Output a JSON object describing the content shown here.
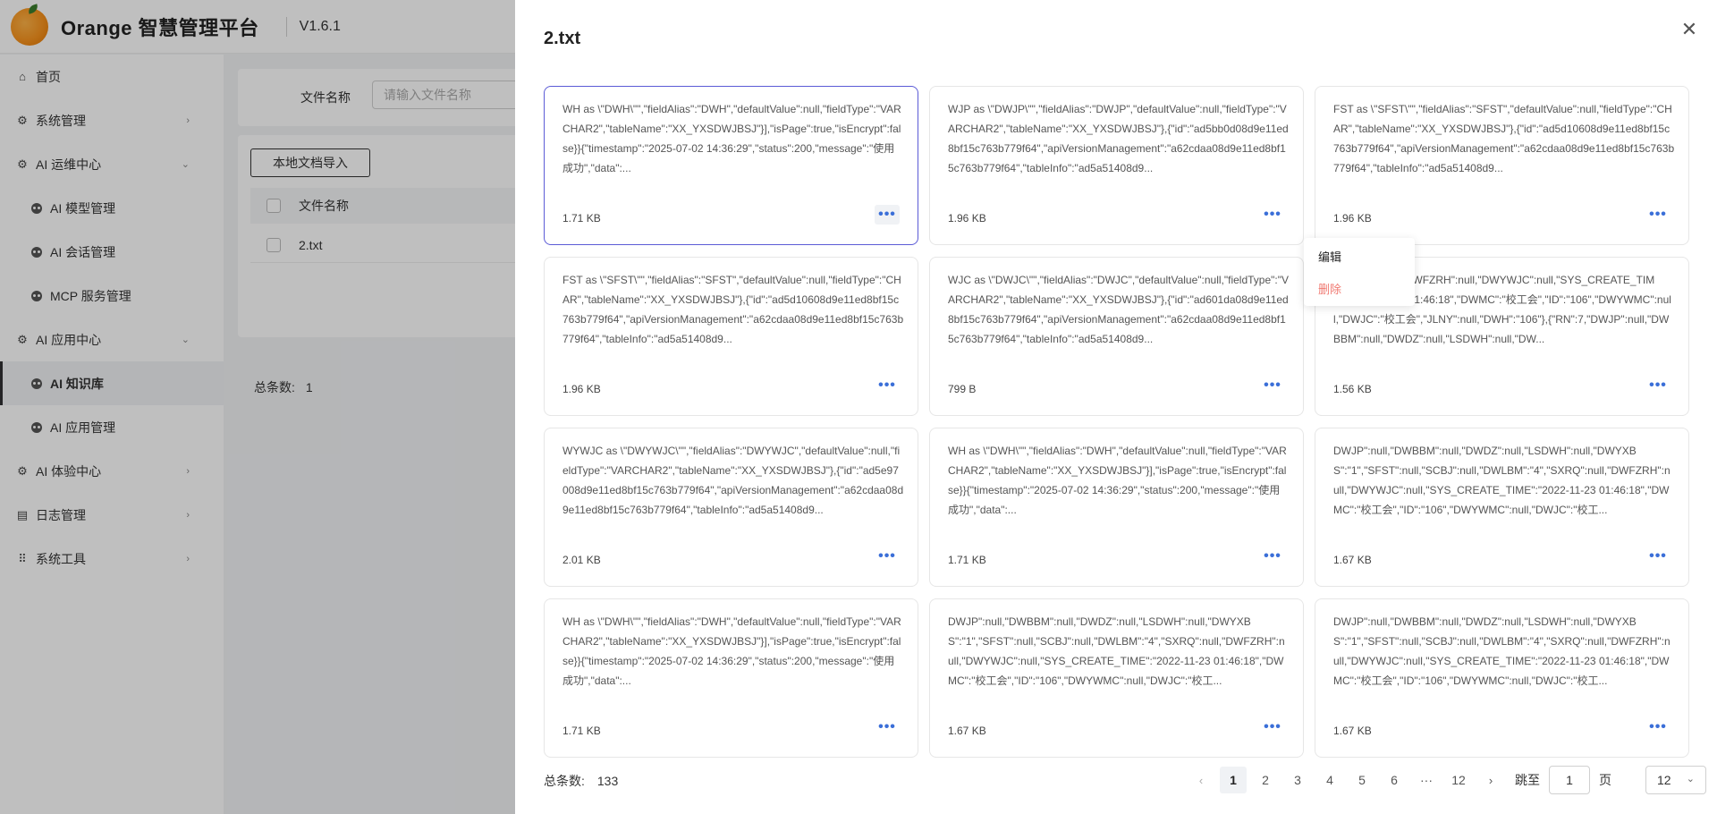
{
  "header": {
    "title": "Orange 智慧管理平台",
    "version": "V1.6.1"
  },
  "sidebar": {
    "items": [
      {
        "label": "首页",
        "icon": "home-icon"
      },
      {
        "label": "系统管理",
        "icon": "gear-icon"
      },
      {
        "label": "AI 运维中心",
        "icon": "gear-icon"
      },
      {
        "label": "AI 模型管理",
        "icon": "ai-icon"
      },
      {
        "label": "AI 会话管理",
        "icon": "ai-icon"
      },
      {
        "label": "MCP 服务管理",
        "icon": "ai-icon"
      },
      {
        "label": "AI 应用中心",
        "icon": "gear-icon"
      },
      {
        "label": "AI 知识库",
        "icon": "ai-icon"
      },
      {
        "label": "AI 应用管理",
        "icon": "ai-icon"
      },
      {
        "label": "AI 体验中心",
        "icon": "gear-icon"
      },
      {
        "label": "日志管理",
        "icon": "log-icon"
      },
      {
        "label": "系统工具",
        "icon": "grid-icon"
      }
    ]
  },
  "main": {
    "search_label": "文件名称",
    "search_placeholder": "请输入文件名称",
    "import_button": "本地文档导入",
    "column_name": "文件名称",
    "rows": [
      "2.txt"
    ],
    "total_label": "总条数:",
    "total_value": "1"
  },
  "drawer": {
    "title": "2.txt",
    "cards": [
      {
        "text": "WH as \\\"DWH\\\"\",\"fieldAlias\":\"DWH\",\"defaultValue\":null,\"fieldType\":\"VARCHAR2\",\"tableName\":\"XX_YXSDWJBSJ\"}],\"isPage\":true,\"isEncrypt\":false}}{\"timestamp\":\"2025-07-02 14:36:29\",\"status\":200,\"message\":\"使用成功\",\"data\":...",
        "size": "1.71 KB"
      },
      {
        "text": "WJP as \\\"DWJP\\\"\",\"fieldAlias\":\"DWJP\",\"defaultValue\":null,\"fieldType\":\"VARCHAR2\",\"tableName\":\"XX_YXSDWJBSJ\"},{\"id\":\"ad5bb0d08d9e11ed8bf15c763b779f64\",\"apiVersionManagement\":\"a62cdaa08d9e11ed8bf15c763b779f64\",\"tableInfo\":\"ad5a51408d9...",
        "size": "1.96 KB"
      },
      {
        "text": "FST as \\\"SFST\\\"\",\"fieldAlias\":\"SFST\",\"defaultValue\":null,\"fieldType\":\"CHAR\",\"tableName\":\"XX_YXSDWJBSJ\"},{\"id\":\"ad5d10608d9e11ed8bf15c763b779f64\",\"apiVersionManagement\":\"a62cdaa08d9e11ed8bf15c763b779f64\",\"tableInfo\":\"ad5a51408d9...",
        "size": "1.96 KB"
      },
      {
        "text": "FST as \\\"SFST\\\"\",\"fieldAlias\":\"SFST\",\"defaultValue\":null,\"fieldType\":\"CHAR\",\"tableName\":\"XX_YXSDWJBSJ\"},{\"id\":\"ad5d10608d9e11ed8bf15c763b779f64\",\"apiVersionManagement\":\"a62cdaa08d9e11ed8bf15c763b779f64\",\"tableInfo\":\"ad5a51408d9...",
        "size": "1.96 KB"
      },
      {
        "text": "WJC as \\\"DWJC\\\"\",\"fieldAlias\":\"DWJC\",\"defaultValue\":null,\"fieldType\":\"VARCHAR2\",\"tableName\":\"XX_YXSDWJBSJ\"},{\"id\":\"ad601da08d9e11ed8bf15c763b779f64\",\"apiVersionManagement\":\"a62cdaa08d9e11ed8bf15c763b779f64\",\"tableInfo\":\"ad5a51408d9...",
        "size": "799 B"
      },
      {
        "text": "\",\"SXRQ\":null,\"DWFZRH\":null,\"DWYWJC\":null,\"SYS_CREATE_TIME\":\"2022-11-23 01:46:18\",\"DWMC\":\"校工会\",\"ID\":\"106\",\"DWYWMC\":null,\"DWJC\":\"校工会\",\"JLNY\":null,\"DWH\":\"106\"},{\"RN\":7,\"DWJP\":null,\"DWBBM\":null,\"DWDZ\":null,\"LSDWH\":null,\"DW...",
        "size": "1.56 KB"
      },
      {
        "text": "WYWJC as \\\"DWYWJC\\\"\",\"fieldAlias\":\"DWYWJC\",\"defaultValue\":null,\"fieldType\":\"VARCHAR2\",\"tableName\":\"XX_YXSDWJBSJ\"},{\"id\":\"ad5e97008d9e11ed8bf15c763b779f64\",\"apiVersionManagement\":\"a62cdaa08d9e11ed8bf15c763b779f64\",\"tableInfo\":\"ad5a51408d9...",
        "size": "2.01 KB"
      },
      {
        "text": "WH as \\\"DWH\\\"\",\"fieldAlias\":\"DWH\",\"defaultValue\":null,\"fieldType\":\"VARCHAR2\",\"tableName\":\"XX_YXSDWJBSJ\"}],\"isPage\":true,\"isEncrypt\":false}}{\"timestamp\":\"2025-07-02 14:36:29\",\"status\":200,\"message\":\"使用成功\",\"data\":...",
        "size": "1.71 KB"
      },
      {
        "text": "DWJP\":null,\"DWBBM\":null,\"DWDZ\":null,\"LSDWH\":null,\"DWYXBS\":\"1\",\"SFST\":null,\"SCBJ\":null,\"DWLBM\":\"4\",\"SXRQ\":null,\"DWFZRH\":null,\"DWYWJC\":null,\"SYS_CREATE_TIME\":\"2022-11-23 01:46:18\",\"DWMC\":\"校工会\",\"ID\":\"106\",\"DWYWMC\":null,\"DWJC\":\"校工...",
        "size": "1.67 KB"
      },
      {
        "text": "WH as \\\"DWH\\\"\",\"fieldAlias\":\"DWH\",\"defaultValue\":null,\"fieldType\":\"VARCHAR2\",\"tableName\":\"XX_YXSDWJBSJ\"}],\"isPage\":true,\"isEncrypt\":false}}{\"timestamp\":\"2025-07-02 14:36:29\",\"status\":200,\"message\":\"使用成功\",\"data\":...",
        "size": "1.71 KB"
      },
      {
        "text": "DWJP\":null,\"DWBBM\":null,\"DWDZ\":null,\"LSDWH\":null,\"DWYXBS\":\"1\",\"SFST\":null,\"SCBJ\":null,\"DWLBM\":\"4\",\"SXRQ\":null,\"DWFZRH\":null,\"DWYWJC\":null,\"SYS_CREATE_TIME\":\"2022-11-23 01:46:18\",\"DWMC\":\"校工会\",\"ID\":\"106\",\"DWYWMC\":null,\"DWJC\":\"校工...",
        "size": "1.67 KB"
      },
      {
        "text": "DWJP\":null,\"DWBBM\":null,\"DWDZ\":null,\"LSDWH\":null,\"DWYXBS\":\"1\",\"SFST\":null,\"SCBJ\":null,\"DWLBM\":\"4\",\"SXRQ\":null,\"DWFZRH\":null,\"DWYWJC\":null,\"SYS_CREATE_TIME\":\"2022-11-23 01:46:18\",\"DWMC\":\"校工会\",\"ID\":\"106\",\"DWYWMC\":null,\"DWJC\":\"校工...",
        "size": "1.67 KB"
      }
    ],
    "dropdown": {
      "edit": "编辑",
      "delete": "删除"
    },
    "total_label": "总条数:",
    "total_value": "133",
    "pagination": {
      "pages": [
        "1",
        "2",
        "3",
        "4",
        "5",
        "6",
        "···",
        "12"
      ],
      "current": "1",
      "jump_label": "跳至",
      "jump_value": "1",
      "page_suffix": "页",
      "page_size": "12"
    }
  },
  "colors": {
    "accent": "#3b6fd8",
    "selected_border": "#5b5bd6",
    "danger": "#f07a72"
  }
}
